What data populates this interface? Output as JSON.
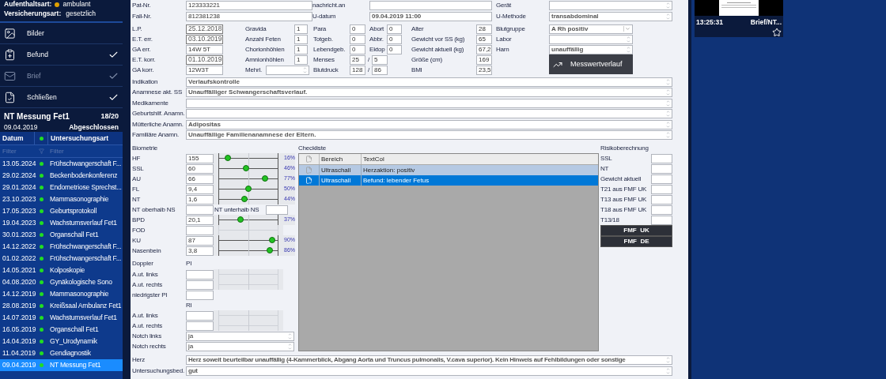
{
  "sidebar": {
    "stay": {
      "label": "Aufenthaltsart:",
      "value": "ambulant",
      "color": "#e0a000"
    },
    "insurance": {
      "label": "Versicherungsart:",
      "value": "gesetzlich"
    },
    "menu": [
      {
        "label": "Bilder",
        "checked": false,
        "disabled": false
      },
      {
        "label": "Befund",
        "checked": true,
        "disabled": false
      },
      {
        "label": "Brief",
        "checked": true,
        "disabled": true
      },
      {
        "label": "Schließen",
        "checked": true,
        "disabled": false
      }
    ],
    "exam": {
      "title": "NT Messung Fet1",
      "count": "18/20",
      "date": "09.04.2019",
      "status": "Abgeschlossen"
    },
    "table": {
      "columns": [
        "Datum",
        "Untersuchungsart"
      ],
      "filter_placeholders": [
        "Filter",
        "Filter"
      ],
      "rows": [
        {
          "date": "13.05.2024",
          "type": "Frühschwangerschaft F...",
          "color": "#22dd22",
          "selected": false
        },
        {
          "date": "29.02.2024",
          "type": "Beckenbodenkonferenz",
          "color": "#22dd22",
          "selected": false
        },
        {
          "date": "29.01.2024",
          "type": "Endometriose Sprechst...",
          "color": "#22dd22",
          "selected": false
        },
        {
          "date": "23.10.2023",
          "type": "Mammasonographie",
          "color": "#22dd22",
          "selected": false
        },
        {
          "date": "17.05.2023",
          "type": "Geburtsprotokoll",
          "color": "#22dd22",
          "selected": false
        },
        {
          "date": "19.04.2023",
          "type": "Wachstumsverlauf Fet1",
          "color": "#22dd22",
          "selected": false
        },
        {
          "date": "30.01.2023",
          "type": "Organschall Fet1",
          "color": "#22dd22",
          "selected": false
        },
        {
          "date": "14.12.2022",
          "type": "Frühschwangerschaft F...",
          "color": "#22dd22",
          "selected": false
        },
        {
          "date": "01.02.2022",
          "type": "Frühschwangerschaft F...",
          "color": "#22dd22",
          "selected": false
        },
        {
          "date": "14.05.2021",
          "type": "Kolposkopie",
          "color": "#22dd22",
          "selected": false
        },
        {
          "date": "04.08.2020",
          "type": "Gynäkologische Sono",
          "color": "#22dd22",
          "selected": false
        },
        {
          "date": "14.12.2019",
          "type": "Mammasonographie",
          "color": "#22dd22",
          "selected": false
        },
        {
          "date": "28.08.2019",
          "type": "Kreißsaal Ambulanz Fet1",
          "color": "#22dd22",
          "selected": false
        },
        {
          "date": "14.07.2019",
          "type": "Wachstumsverlauf Fet1",
          "color": "#22dd22",
          "selected": false
        },
        {
          "date": "16.05.2019",
          "type": "Organschall Fet1",
          "color": "#22dd22",
          "selected": false
        },
        {
          "date": "14.04.2019",
          "type": "GY_Urodynamik",
          "color": "#22dd22",
          "selected": false
        },
        {
          "date": "11.04.2019",
          "type": "Gendiagnostik",
          "color": "#22dd22",
          "selected": false
        },
        {
          "date": "09.04.2019",
          "type": "NT Messung Fet1",
          "color": "#22dd22",
          "selected": true
        }
      ]
    }
  },
  "form": {
    "header_rows": [
      [
        {
          "label": "Pat-Nr.",
          "value": "123333221"
        },
        {
          "label": "nachricht.an"
        },
        {
          "label": "Gerät"
        }
      ],
      [
        {
          "label": "Fall-Nr.",
          "value": "812381238"
        },
        {
          "label": "U-datum",
          "value": "09.04.2019 11:00"
        },
        {
          "label": "U-Methode",
          "value": "transabdominal"
        }
      ]
    ],
    "obstetrics": {
      "rows": [
        [
          {
            "kind": "date",
            "label": "L.P.",
            "value": "25.12.2018"
          },
          {
            "kind": "field",
            "label": "Gravida",
            "value": "1"
          },
          {
            "kind": "field",
            "label": "Para",
            "value": "0"
          },
          {
            "kind": "field",
            "label": "Abort",
            "value": "0"
          },
          {
            "kind": "field",
            "label": "Alter",
            "value": "28"
          }
        ],
        [
          {
            "kind": "date",
            "label": "E.T. err.",
            "value": "03.10.2019"
          },
          {
            "kind": "field",
            "label": "Anzahl Feten",
            "value": "1"
          },
          {
            "kind": "field",
            "label": "Totgeb.",
            "value": "0"
          },
          {
            "kind": "field",
            "label": "Abbr.",
            "value": "0"
          },
          {
            "kind": "field",
            "label": "Gewicht vor SS (kg)",
            "value": "65"
          }
        ],
        [
          {
            "kind": "field",
            "label": "GA err.",
            "value": "14W 5T"
          },
          {
            "kind": "field",
            "label": "Chorionhöhlen",
            "value": "1"
          },
          {
            "kind": "field",
            "label": "Lebendgeb.",
            "value": "0"
          },
          {
            "kind": "field",
            "label": "Ektop",
            "value": "0"
          },
          {
            "kind": "field",
            "label": "Gewicht aktuell (kg)",
            "value": "67,2"
          }
        ],
        [
          {
            "kind": "date",
            "label": "E.T. korr.",
            "value": "01.10.2019"
          },
          {
            "kind": "field",
            "label": "Amnionhöhlen",
            "value": "1"
          },
          {
            "kind": "pair",
            "label": "Menses",
            "value": "25",
            "separator": "/",
            "value_2": "5"
          },
          {
            "kind": "field",
            "label": "Größe (cm)",
            "value": "169"
          }
        ],
        [
          {
            "kind": "field",
            "label": "GA korr.",
            "value": "12W3T"
          },
          {
            "kind": "spinner",
            "label": "Mehrl."
          },
          {
            "kind": "pair",
            "label": "Blutdruck",
            "value": "128",
            "separator": "/",
            "value_2": "86"
          },
          {
            "kind": "field",
            "label": "BMI",
            "value": "23,5"
          }
        ]
      ],
      "lab": [
        {
          "kind": "dropdown",
          "label": "Blutgruppe",
          "value": "A Rh positiv"
        },
        {
          "kind": "scroll",
          "label": "Labor"
        },
        {
          "kind": "scroll",
          "label": "Harn",
          "value": "unauffällig"
        }
      ],
      "chart_button": {
        "label": "Messwertverlauf"
      }
    },
    "anamnesis": [
      {
        "label": "Indikation",
        "value": "Verlaufskontrolle"
      },
      {
        "label": "Anamnese akt. SS",
        "value": "Unauffälliger Schwangerschaftsverlauf."
      },
      {
        "label": "Medikamente"
      },
      {
        "label": "Geburtshilf. Anamn."
      },
      {
        "label": "Mütterliche Anamn.",
        "value": "Adipositas"
      },
      {
        "label": "Familiäre Anamn.",
        "value": "Unauffällige Familienanamnese der Eltern."
      }
    ],
    "biometrie": {
      "title": "Biometrie",
      "rows": [
        {
          "kind": "slider",
          "label": "HF",
          "value": "155",
          "level": 0.16,
          "reading": "16%"
        },
        {
          "kind": "slider",
          "label": "SSL",
          "value": "60",
          "level": 0.46,
          "reading": "46%"
        },
        {
          "kind": "slider",
          "label": "AU",
          "value": "66",
          "level": 0.77,
          "reading": "77%"
        },
        {
          "kind": "slider",
          "label": "FL",
          "value": "9,4",
          "level": 0.5,
          "reading": "50%"
        },
        {
          "kind": "slider",
          "label": "NT",
          "value": "1,6",
          "level": 0.44,
          "reading": "44%"
        },
        {
          "kind": "pair",
          "label": "NT oberhalb NS",
          "label_2": "NT unterhalb NS"
        },
        {
          "kind": "slider",
          "label": "BPD",
          "value": "20,1",
          "level": 0.37,
          "reading": "37%"
        },
        {
          "kind": "empty",
          "label": "FOD"
        },
        {
          "kind": "slider",
          "label": "KU",
          "value": "87",
          "level": 0.9,
          "reading": "90%"
        },
        {
          "kind": "slider",
          "label": "Nasenbein",
          "value": "3,8",
          "level": 0.86,
          "reading": "86%"
        }
      ]
    },
    "doppler": {
      "title": "Doppler",
      "pi_label": "PI",
      "pi_rows": [
        {
          "kind": "empty",
          "label": "A.ut. links"
        },
        {
          "kind": "empty",
          "label": "A.ut. rechts"
        },
        {
          "kind": "plain",
          "label": "niedrigster PI"
        }
      ],
      "ri_label": "RI",
      "ri_rows": [
        {
          "kind": "empty",
          "label": "A.ut. links"
        },
        {
          "kind": "empty",
          "label": "A.ut. rechts"
        }
      ],
      "notch_rows": [
        {
          "label": "Notch links",
          "value": "ja"
        },
        {
          "label": "Notch rechts",
          "value": "ja"
        }
      ]
    },
    "checklist": {
      "title": "Checkliste",
      "columns": [
        "Bereich",
        "TextCol"
      ],
      "rows": [
        {
          "area": "Ultraschall",
          "text": "Herzaktion: positiv",
          "marked": true,
          "selected": false
        },
        {
          "area": "Ultraschall",
          "text": "Befund: lebender Fetus",
          "marked": false,
          "selected": true
        }
      ]
    },
    "risk": {
      "title": "Risikoberechnung",
      "rows": [
        "SSL",
        "NT",
        "Gewicht aktuell",
        "T21 aus FMF UK",
        "T13 aus FMF UK",
        "T18 aus FMF UK",
        "T13/18"
      ],
      "buttons": [
        "FMF  UK",
        "FMF  DE"
      ]
    },
    "findings": [
      {
        "label": "Herz",
        "value": "Herz soweit beurteilbar unauffällig (4-Kammerblick, Abgang Aorta und Truncus pulmonalis, V.cava superior). Kein Hinweis auf Fehlbildungen oder sonstige"
      },
      {
        "label": "Untersuchungsbed.",
        "value": "gut"
      }
    ]
  },
  "preview": {
    "time": "13:25:31",
    "title": "Brief/NT..."
  }
}
